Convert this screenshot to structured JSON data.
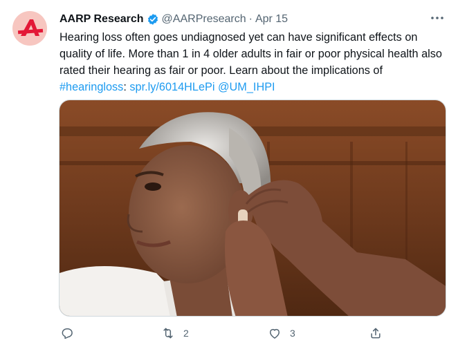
{
  "tweet": {
    "display_name": "AARP Research",
    "handle": "@AARPresearch",
    "separator": "·",
    "date": "Apr 15",
    "text_parts": {
      "body": "Hearing loss often goes undiagnosed yet can have significant effects on quality of life. More than 1 in 4 older adults in fair or poor physical health also rated their hearing as fair or poor. Learn about the implications of ",
      "hashtag": "#hearingloss",
      "colon": ": ",
      "link": "spr.ly/6014HLePi",
      "space": " ",
      "mention": "@UM_IHPI"
    },
    "avatar_letter": "A"
  },
  "actions": {
    "reply_icon": "reply-icon",
    "retweet_icon": "retweet-icon",
    "retweet_count": "2",
    "like_icon": "heart-icon",
    "like_count": "3",
    "share_icon": "share-icon"
  },
  "colors": {
    "link": "#1d9bf0",
    "secondary_text": "#536471",
    "aarp_red": "#e31837",
    "avatar_bg": "#f7c6c0",
    "verified": "#1d9bf0"
  }
}
